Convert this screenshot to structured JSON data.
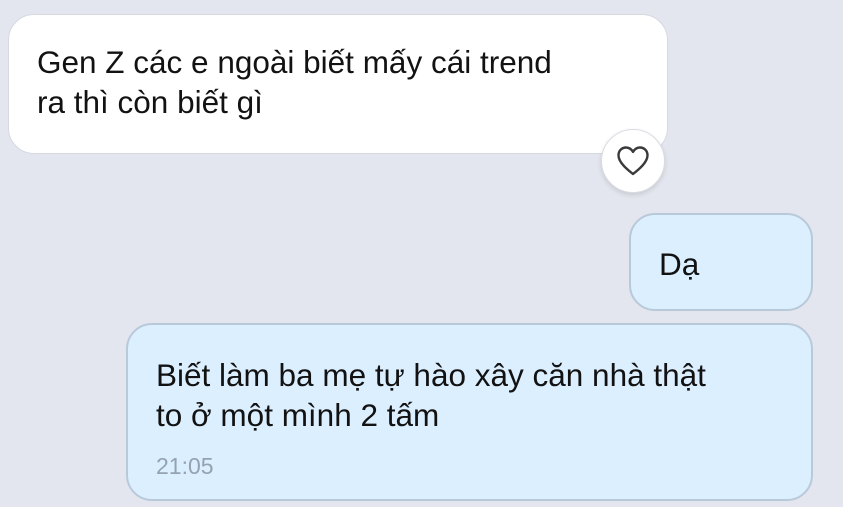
{
  "chat": {
    "messages": [
      {
        "direction": "incoming",
        "text": "Gen Z các e ngoài biết mấy cái trend\nra thì còn biết gì",
        "reaction_icon": "heart-outline-icon"
      },
      {
        "direction": "outgoing",
        "text": "Dạ"
      },
      {
        "direction": "outgoing",
        "text": "Biết làm ba mẹ tự hào xây căn nhà thật\nto ở một mình 2 tấm",
        "time": "21:05"
      }
    ]
  },
  "colors": {
    "background": "#e3e6ee",
    "incoming_bubble": "#ffffff",
    "outgoing_bubble": "#dcefff",
    "outgoing_border": "#b8cad9",
    "timestamp": "#95a3b0"
  }
}
